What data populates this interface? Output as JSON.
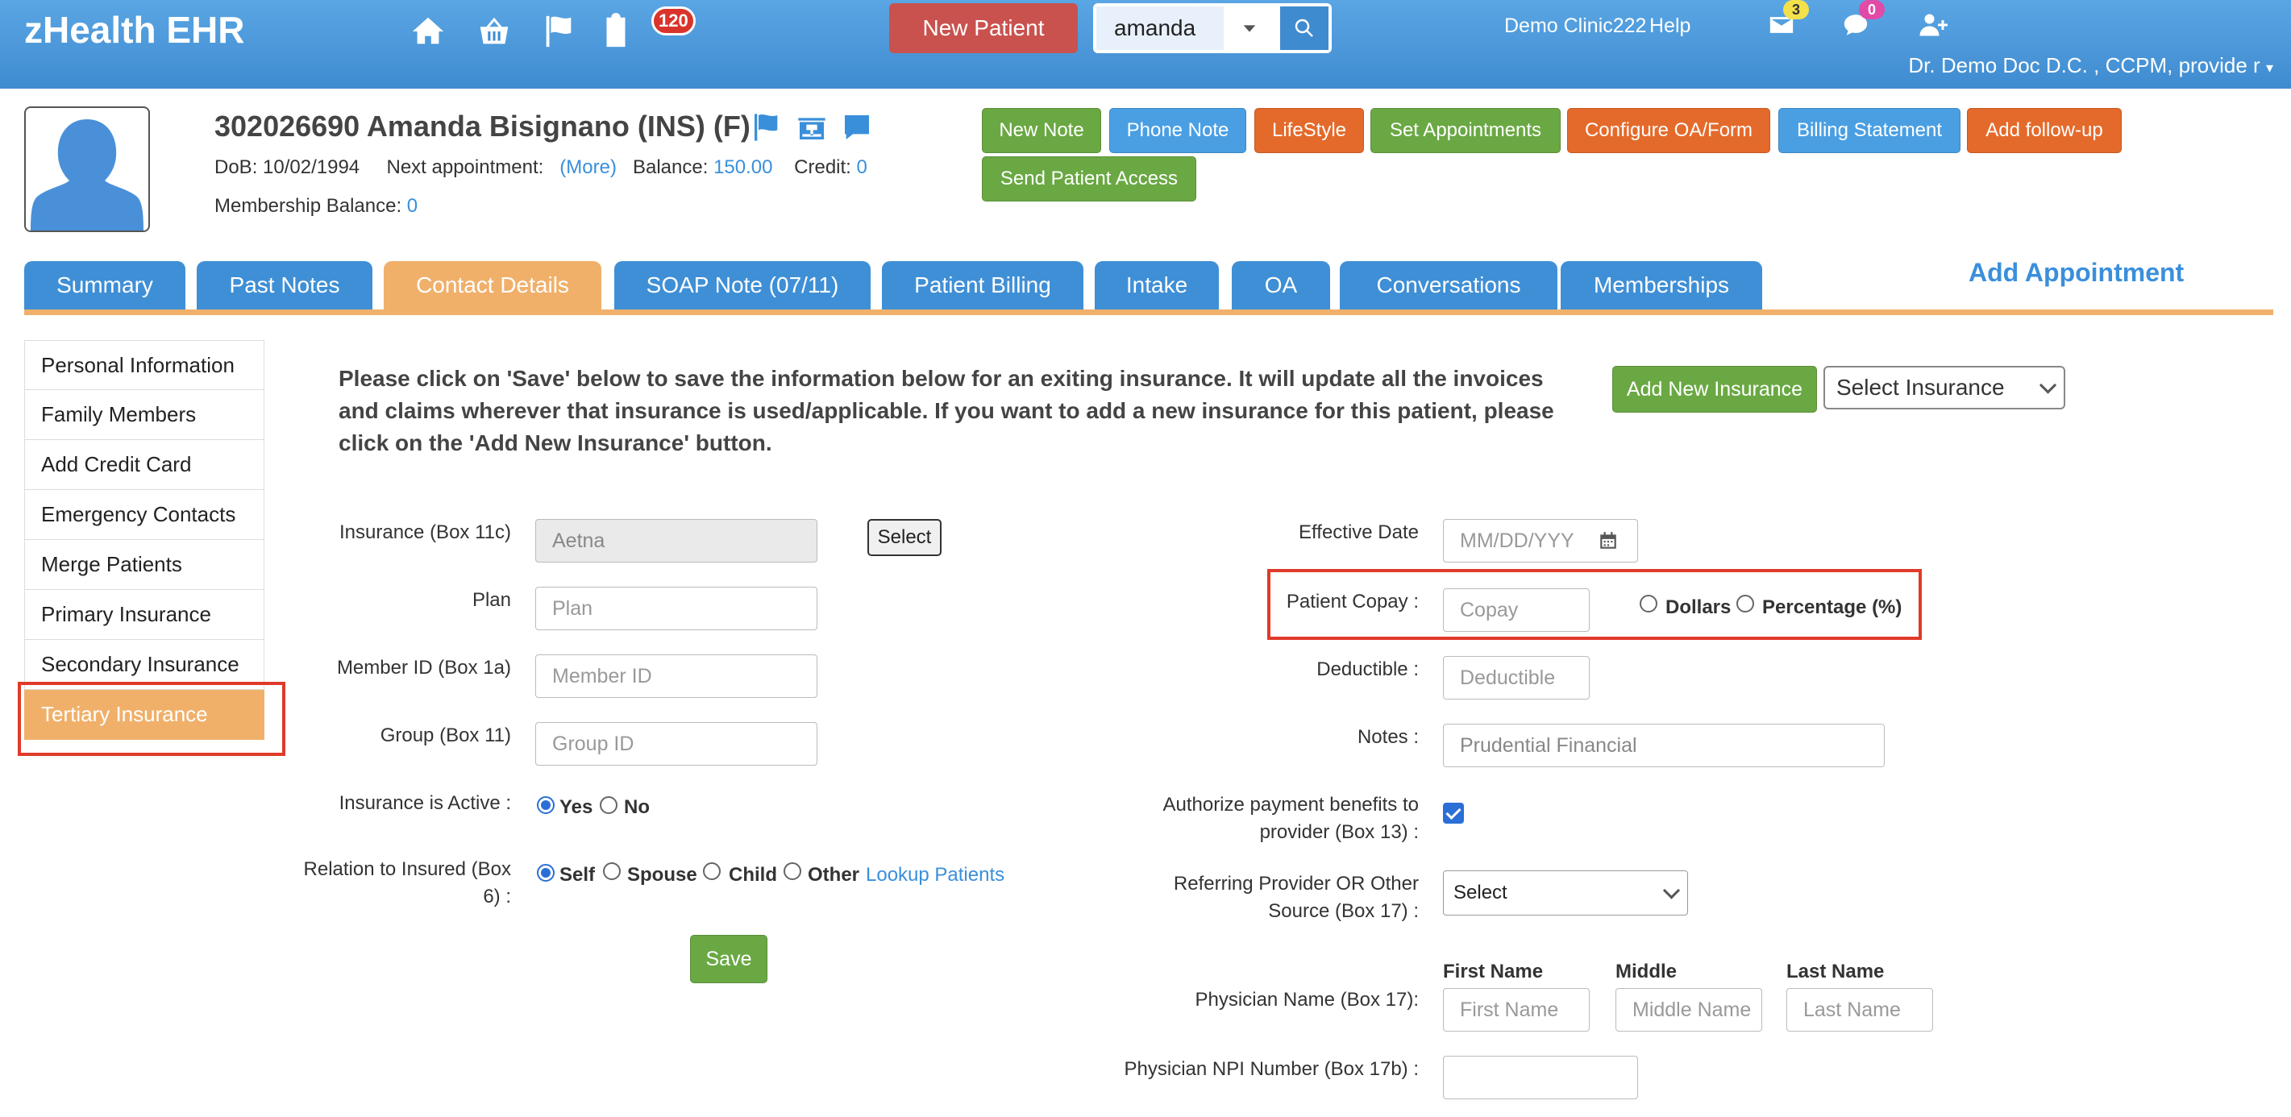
{
  "app": {
    "title": "zHealth EHR"
  },
  "nav": {
    "badge_tasks": "120",
    "new_patient": "New Patient",
    "search_value": "amanda",
    "clinic": "Demo Clinic222",
    "help": "Help",
    "mail_count": "3",
    "chat_count": "0",
    "user": "Dr. Demo Doc D.C. , CCPM, provide r"
  },
  "patient": {
    "name": "302026690 Amanda Bisignano  (INS) (F)",
    "dob_label": "DoB:",
    "dob": "10/02/1994",
    "next_appt_label": "Next appointment:",
    "more": "(More)",
    "balance_label": "Balance:",
    "balance": "150.00",
    "credit_label": "Credit:",
    "credit": "0",
    "membership_label": "Membership Balance:",
    "membership": "0"
  },
  "actions": {
    "new_note": "New Note",
    "phone_note": "Phone Note",
    "lifestyle": "LifeStyle",
    "set_appointments": "Set Appointments",
    "configure": "Configure OA/Form",
    "billing": "Billing Statement",
    "followup": "Add follow-up",
    "send_access": "Send Patient Access"
  },
  "tabs": {
    "summary": "Summary",
    "past_notes": "Past Notes",
    "contact": "Contact Details",
    "soap": "SOAP Note (07/11)",
    "billing": "Patient Billing",
    "intake": "Intake",
    "oa": "OA",
    "conversations": "Conversations",
    "memberships": "Memberships",
    "add_appointment": "Add Appointment"
  },
  "sidebar": {
    "items": [
      "Personal Information",
      "Family Members",
      "Add Credit Card",
      "Emergency Contacts",
      "Merge Patients",
      "Primary Insurance",
      "Secondary Insurance",
      "Tertiary Insurance"
    ]
  },
  "form": {
    "info": "Please click on 'Save' below to save the information below for an exiting insurance. It will update all the invoices and claims wherever that insurance is used/applicable. If you want to add a new insurance for this patient, please click on the 'Add New Insurance' button.",
    "add_new_insurance": "Add New Insurance",
    "select_insurance": "Select Insurance",
    "insurance_label": "Insurance (Box 11c)",
    "insurance_value": "Aetna",
    "select_btn": "Select",
    "plan_label": "Plan",
    "plan_ph": "Plan",
    "member_label": "Member ID (Box 1a)",
    "member_ph": "Member ID",
    "group_label": "Group (Box 11)",
    "group_ph": "Group ID",
    "active_label": "Insurance is Active :",
    "yes": "Yes",
    "no": "No",
    "relation_label_1": "Relation to Insured (Box",
    "relation_label_2": "6) :",
    "self": "Self",
    "spouse": "Spouse",
    "child": "Child",
    "other": "Other",
    "lookup": "Lookup Patients",
    "save": "Save",
    "effective_label": "Effective Date",
    "effective_ph": "MM/DD/YYY",
    "copay_label": "Patient Copay :",
    "copay_ph": "Copay",
    "dollars": "Dollars",
    "percentage": "Percentage (%)",
    "deductible_label": "Deductible :",
    "deductible_ph": "Deductible",
    "notes_label": "Notes :",
    "notes_value": "Prudential Financial",
    "authorize_label_1": "Authorize payment benefits to",
    "authorize_label_2": "provider (Box 13) :",
    "referring_label_1": "Referring Provider OR Other",
    "referring_label_2": "Source (Box 17) :",
    "referring_value": "Select",
    "first_name_head": "First Name",
    "middle_head": "Middle",
    "last_name_head": "Last Name",
    "physician_label": "Physician Name (Box 17):",
    "first_ph": "First Name",
    "middle_ph": "Middle Name",
    "last_ph": "Last Name",
    "npi_label": "Physician NPI Number (Box 17b) :"
  }
}
